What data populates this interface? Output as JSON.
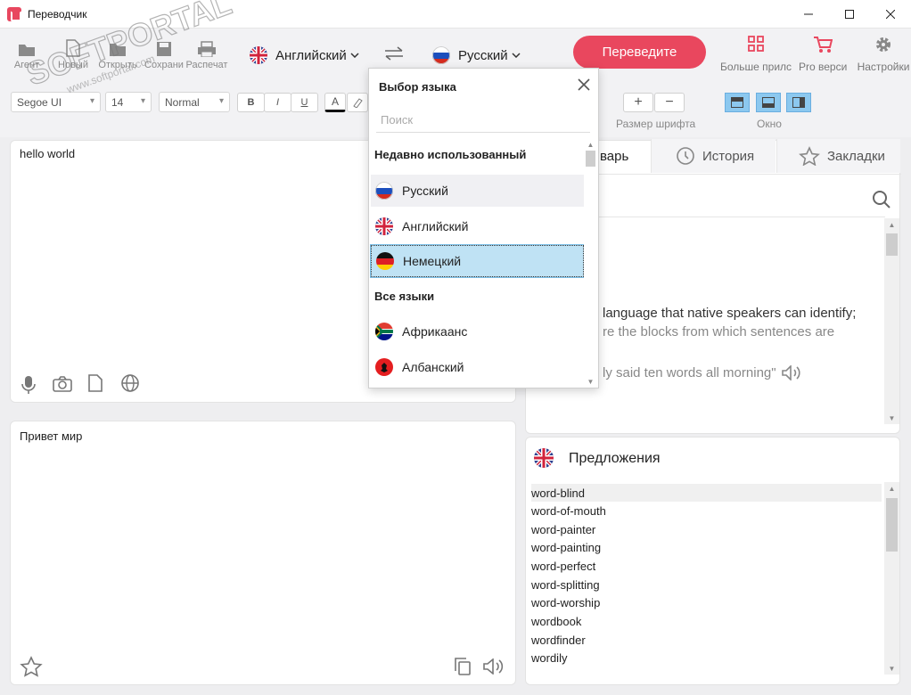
{
  "window": {
    "title": "Переводчик"
  },
  "toolbar": {
    "items": [
      {
        "label": "Агент",
        "icon": "agent-icon"
      },
      {
        "label": "Новый",
        "icon": "new-document-icon"
      },
      {
        "label": "Открыть",
        "icon": "folder-icon"
      },
      {
        "label": "Сохрани",
        "icon": "save-icon"
      },
      {
        "label": "Распечат",
        "icon": "print-icon"
      }
    ],
    "source_lang": "Английский",
    "target_lang": "Русский",
    "translate_label": "Переведите",
    "right_items": [
      {
        "label": "Больше прилс",
        "icon": "apps-icon"
      },
      {
        "label": "Pro верси",
        "icon": "cart-icon"
      },
      {
        "label": "Настройки",
        "icon": "gear-icon"
      }
    ],
    "font_name": "Segoe UI",
    "font_size": "14",
    "style": "Normal",
    "bold": "B",
    "italic": "I",
    "underline": "U",
    "font_color_glyph": "A",
    "size_label": "Размер шрифта",
    "zoom_in": "+",
    "zoom_out": "−",
    "window_label": "Окно"
  },
  "source": {
    "text": "hello world"
  },
  "target": {
    "text": "Привет мир"
  },
  "dropdown": {
    "title": "Выбор языка",
    "search_placeholder": "Поиск",
    "recent_header": "Недавно использованный",
    "all_header": "Все языки",
    "recent": [
      "Русский",
      "Английский",
      "Немецкий"
    ],
    "all": [
      "Африкаанс",
      "Албанский"
    ],
    "selected": "Немецкий"
  },
  "dictionary": {
    "tabs": [
      "варь",
      "История",
      "Закладки"
    ],
    "line1": "language that native speakers can identify;",
    "line2": "re the blocks from which sentences are",
    "example": "ly said ten words all morning\""
  },
  "suggestions": {
    "title": "Предложения",
    "items": [
      "word-blind",
      "word-of-mouth",
      "word-painter",
      "word-painting",
      "word-perfect",
      "word-splitting",
      "word-worship",
      "wordbook",
      "wordfinder",
      "wordily"
    ]
  },
  "watermark": "SOFTPORTAL www.softportal.com",
  "colors": {
    "accent": "#e9475e",
    "selection": "#bfe2f4",
    "window_btn": "#8cc8ef"
  }
}
